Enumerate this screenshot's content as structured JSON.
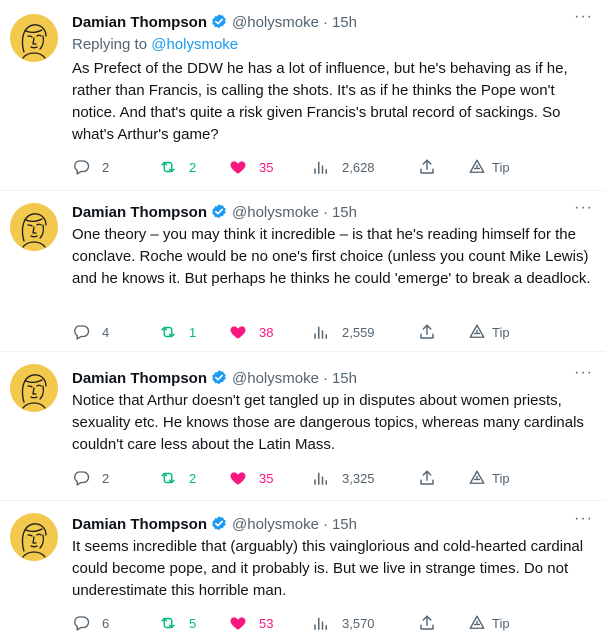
{
  "tweets": [
    {
      "author": "Damian Thompson",
      "handle": "@holysmoke",
      "time": "15h",
      "replying_prefix": "Replying to ",
      "replying_handle": "@holysmoke",
      "text": "As Prefect of the DDW he has a lot of influence, but he's behaving as if he, rather than Francis, is calling the shots. It's as if he thinks the Pope won't notice. And that's quite a risk given Francis's brutal record of sackings. So what's Arthur's game?",
      "replies": "2",
      "retweets": "2",
      "likes": "35",
      "views": "2,628",
      "tip_label": "Tip"
    },
    {
      "author": "Damian Thompson",
      "handle": "@holysmoke",
      "time": "15h",
      "text": "One theory – you may think it incredible – is that he's reading himself for the conclave. Roche would be no one's first choice (unless you count Mike Lewis) and he knows it. But perhaps he thinks he could 'emerge' to break a deadlock.",
      "replies": "4",
      "retweets": "1",
      "likes": "38",
      "views": "2,559",
      "tip_label": "Tip"
    },
    {
      "author": "Damian Thompson",
      "handle": "@holysmoke",
      "time": "15h",
      "text": "Notice that Arthur doesn't get tangled up in disputes about women priests, sexuality etc. He knows those are dangerous topics, whereas many cardinals couldn't care less about the Latin Mass.",
      "replies": "2",
      "retweets": "2",
      "likes": "35",
      "views": "3,325",
      "tip_label": "Tip"
    },
    {
      "author": "Damian Thompson",
      "handle": "@holysmoke",
      "time": "15h",
      "text": "It seems incredible that (arguably) this vainglorious and cold-hearted cardinal could become pope, and it probably is. But we live in strange times. Do not underestimate this horrible man.",
      "replies": "6",
      "retweets": "5",
      "likes": "53",
      "views": "3,570",
      "tip_label": "Tip"
    }
  ],
  "separator_dot": "·",
  "more_glyph": "···",
  "icons": {
    "reply": "reply-icon",
    "retweet": "retweet-icon",
    "like": "heart-icon",
    "views": "views-icon",
    "share": "share-icon",
    "tip": "tip-icon",
    "verified": "verified-badge-icon",
    "more": "more-icon"
  },
  "colors": {
    "verified": "#1d9bf0",
    "retweet": "#00ba7c",
    "like": "#f91880",
    "muted": "#536471",
    "avatar_bg": "#f2c94c"
  }
}
